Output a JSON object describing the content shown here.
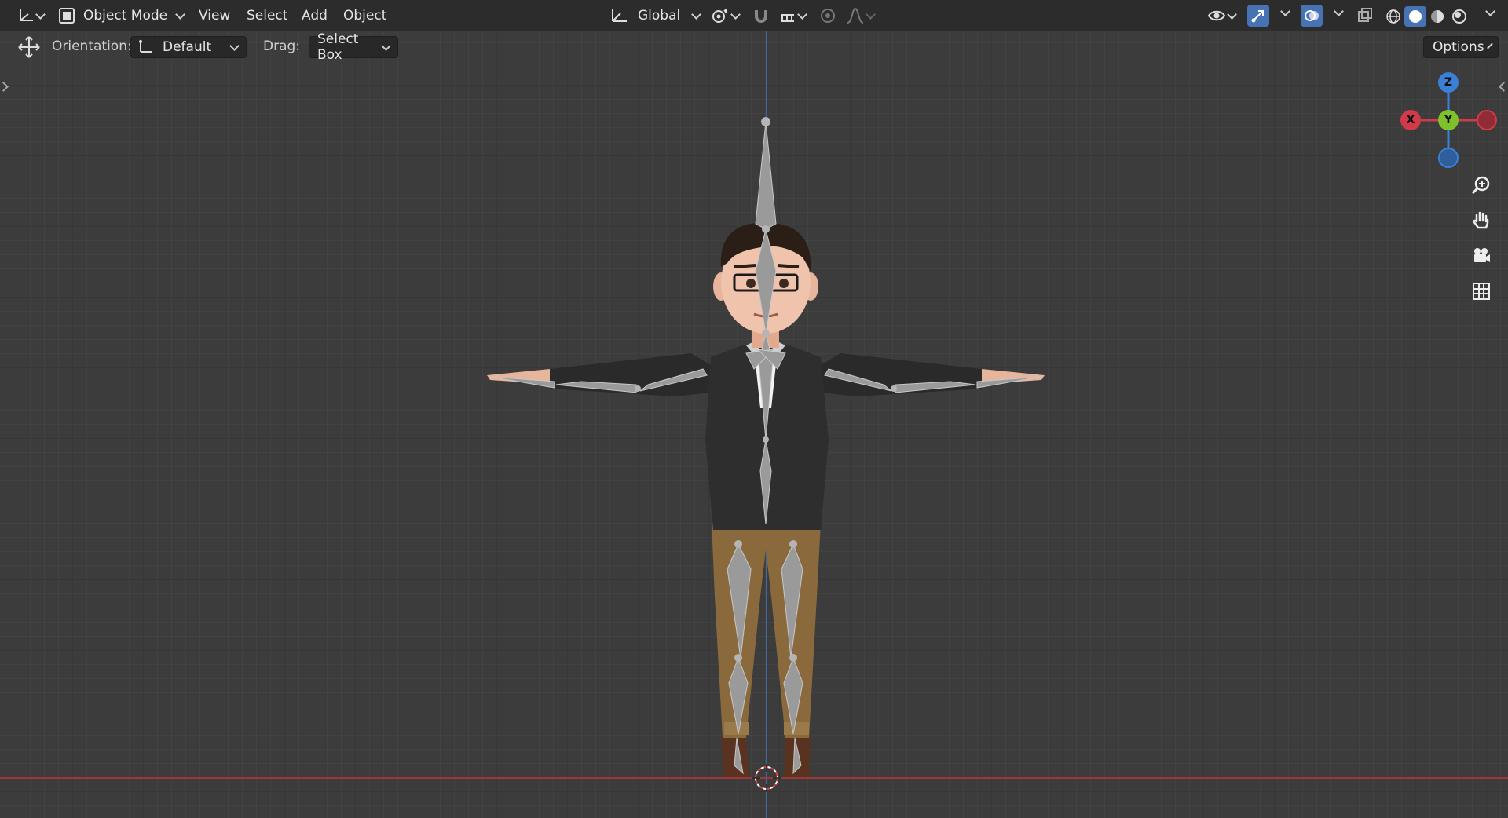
{
  "header": {
    "mode_label": "Object Mode",
    "menus": [
      "View",
      "Select",
      "Add",
      "Object"
    ],
    "transform_orientation": "Global",
    "options_label": "Options"
  },
  "toolbar": {
    "orientation_label": "Orientation:",
    "orientation_value": "Default",
    "drag_label": "Drag:",
    "drag_value": "Select Box"
  },
  "gizmo": {
    "x_label": "X",
    "y_label": "Y",
    "z_label": "Z",
    "x_color": "#d13a48",
    "y_color": "#7dc22b",
    "z_color": "#3b7fd6"
  },
  "navigation": {
    "icons": [
      "zoom-icon",
      "hand-pan-icon",
      "camera-icon",
      "grid-icon"
    ]
  },
  "viewport": {
    "object": "character-armature-rig",
    "accent": "#4772b3"
  }
}
